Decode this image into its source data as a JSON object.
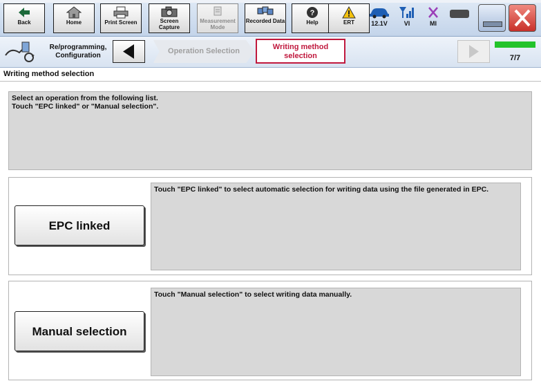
{
  "toolbar": {
    "buttons": [
      {
        "label": "Back",
        "icon": "back-arrow-icon"
      },
      {
        "label": "Home",
        "icon": "home-icon"
      },
      {
        "label": "Print Screen",
        "icon": "printer-icon"
      },
      {
        "label": "Screen Capture",
        "icon": "camera-icon"
      },
      {
        "label": "Measurement Mode",
        "icon": "measurement-icon"
      },
      {
        "label": "Recorded Data",
        "icon": "recorded-data-icon"
      },
      {
        "label": "Help",
        "icon": "help-icon"
      },
      {
        "label": "ERT",
        "icon": "warning-icon"
      }
    ],
    "status": {
      "battery_voltage": "12.1V",
      "vi_label": "VI",
      "mi_label": "MI"
    }
  },
  "breadcrumb": {
    "section": "Re/programming, Configuration",
    "step_previous": "Operation Selection",
    "step_current": "Writing method selection",
    "progress_text": "7/7",
    "progress_fraction": 1.0
  },
  "page": {
    "title": "Writing method selection",
    "instruction_line1": "Select an operation from the following list.",
    "instruction_line2": "Touch \"EPC linked\" or \"Manual selection\"."
  },
  "options": [
    {
      "button_label": "EPC linked",
      "description": "Touch \"EPC linked\" to select automatic selection for writing data using the file generated in EPC."
    },
    {
      "button_label": "Manual selection",
      "description": "Touch \"Manual selection\" to select writing data manually."
    }
  ],
  "colors": {
    "accent_current_step": "#c0183d",
    "progress_green": "#22c32a",
    "status_icon_blue": "#1f5fb4",
    "close_red": "#d9403a"
  }
}
